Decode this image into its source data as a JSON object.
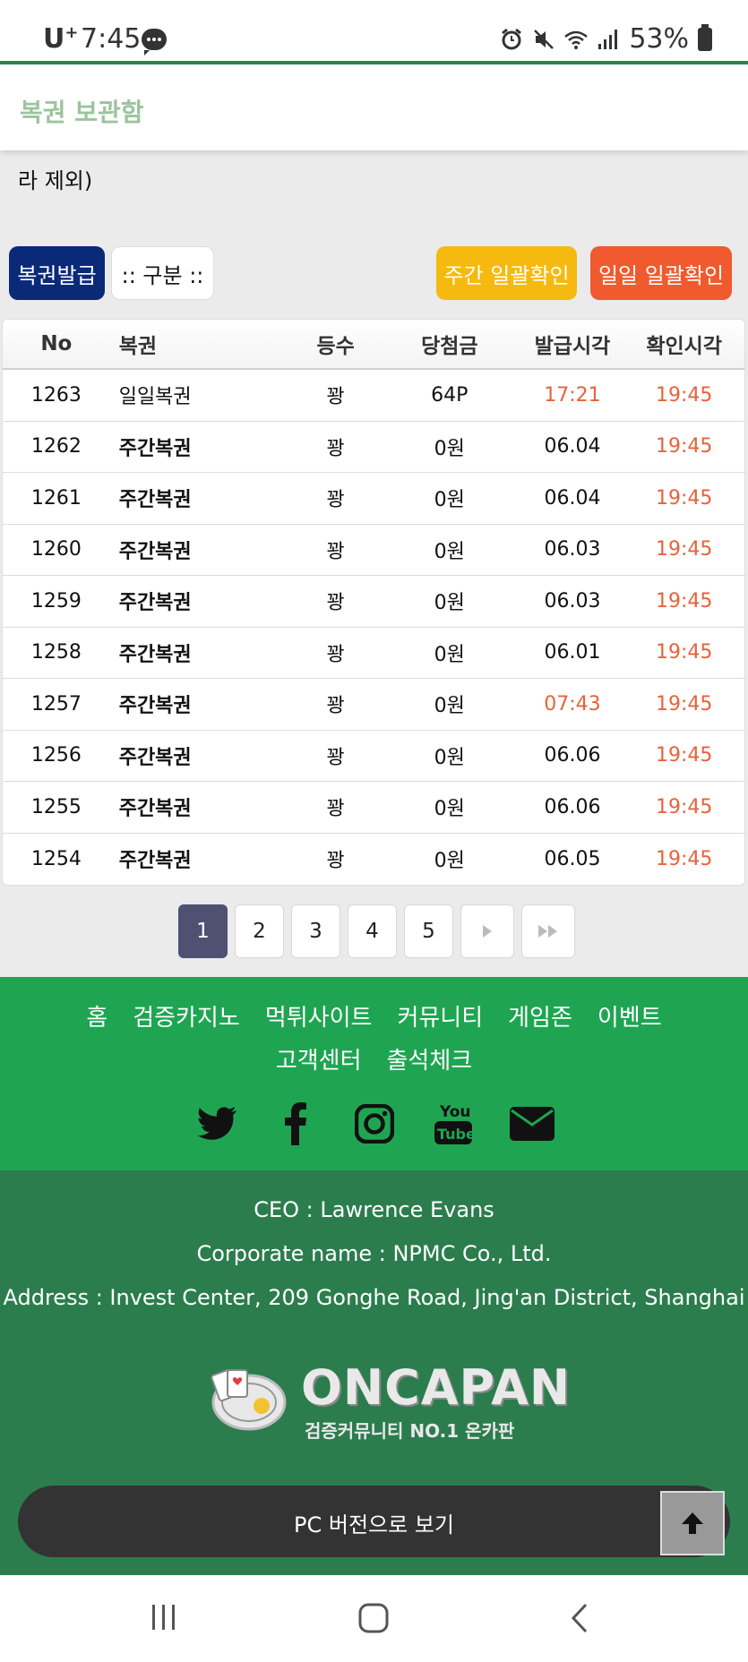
{
  "status_bar": {
    "carrier": "U",
    "carrier_sup": "+",
    "time": "7:45",
    "battery": "53%"
  },
  "header": {
    "title": "복권 보관함"
  },
  "note": "라 제외)",
  "buttons": {
    "issue": "복권발급",
    "category": ":: 구분 ::",
    "weekly_check": "주간 일괄확인",
    "daily_check": "일일 일괄확인"
  },
  "table": {
    "columns": [
      "No",
      "복권",
      "등수",
      "당첨금",
      "발급시각",
      "확인시각"
    ],
    "rows": [
      {
        "no": "1263",
        "type": "일일복권",
        "rank": "꽝",
        "prize": "64P",
        "issued": "17:21",
        "checked": "19:45"
      },
      {
        "no": "1262",
        "type": "주간복권",
        "rank": "꽝",
        "prize": "0원",
        "issued": "06.04",
        "checked": "19:45"
      },
      {
        "no": "1261",
        "type": "주간복권",
        "rank": "꽝",
        "prize": "0원",
        "issued": "06.04",
        "checked": "19:45"
      },
      {
        "no": "1260",
        "type": "주간복권",
        "rank": "꽝",
        "prize": "0원",
        "issued": "06.03",
        "checked": "19:45"
      },
      {
        "no": "1259",
        "type": "주간복권",
        "rank": "꽝",
        "prize": "0원",
        "issued": "06.03",
        "checked": "19:45"
      },
      {
        "no": "1258",
        "type": "주간복권",
        "rank": "꽝",
        "prize": "0원",
        "issued": "06.01",
        "checked": "19:45"
      },
      {
        "no": "1257",
        "type": "주간복권",
        "rank": "꽝",
        "prize": "0원",
        "issued": "07:43",
        "checked": "19:45"
      },
      {
        "no": "1256",
        "type": "주간복권",
        "rank": "꽝",
        "prize": "0원",
        "issued": "06.06",
        "checked": "19:45"
      },
      {
        "no": "1255",
        "type": "주간복권",
        "rank": "꽝",
        "prize": "0원",
        "issued": "06.06",
        "checked": "19:45"
      },
      {
        "no": "1254",
        "type": "주간복권",
        "rank": "꽝",
        "prize": "0원",
        "issued": "06.05",
        "checked": "19:45"
      }
    ]
  },
  "pagination": {
    "pages": [
      "1",
      "2",
      "3",
      "4",
      "5"
    ],
    "current": "1"
  },
  "footer_nav": [
    "홈",
    "검증카지노",
    "먹튀사이트",
    "커뮤니티",
    "게임존",
    "이벤트",
    "고객센터",
    "출석체크"
  ],
  "social_icons": [
    "twitter-icon",
    "facebook-icon",
    "instagram-icon",
    "youtube-icon",
    "mail-icon"
  ],
  "company": {
    "ceo": "CEO : Lawrence Evans",
    "corporate": "Corporate name : NPMC Co., Ltd.",
    "address": "Address : Invest Center, 209 Gonghe Road, Jing'an District, Shanghai"
  },
  "logo": {
    "title": "ONCAPAN",
    "subtitle": "검증커뮤니티 NO.1 온카판"
  },
  "pc_version_label": "PC 버전으로 보기",
  "colors": {
    "brand_green": "#1fa552",
    "dark_green": "#2b7d4e",
    "accent_red": "#e8623a",
    "navy": "#0a2a78",
    "yellow": "#f6b90f",
    "orange": "#f05a2e"
  }
}
